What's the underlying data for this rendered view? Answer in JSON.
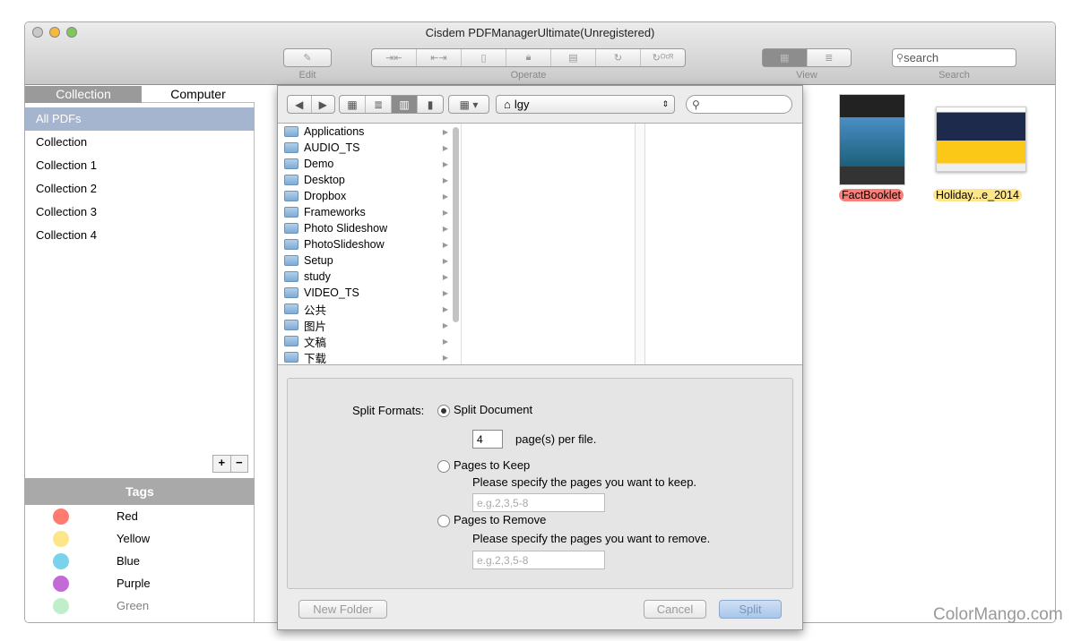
{
  "window": {
    "title": "Cisdem PDFManagerUltimate(Unregistered)"
  },
  "toolbar": {
    "edit_label": "Edit",
    "operate_label": "Operate",
    "view_label": "View",
    "search_label": "Search",
    "search_placeholder": "search",
    "operate_icons": [
      "merge-icon",
      "split-icon",
      "compress-icon",
      "lock-icon",
      "extract-icon",
      "rotate-icon",
      "ocr-icon"
    ]
  },
  "sidebar": {
    "tabs": [
      "Collection",
      "Computer"
    ],
    "items": [
      "All PDFs",
      "Collection",
      "Collection 1",
      "Collection 2",
      "Collection 3",
      "Collection 4"
    ],
    "tags_title": "Tags",
    "tags": [
      {
        "name": "Red",
        "color": "#ff7b72"
      },
      {
        "name": "Yellow",
        "color": "#fde58a"
      },
      {
        "name": "Blue",
        "color": "#79d3ea"
      },
      {
        "name": "Purple",
        "color": "#c46ad6"
      },
      {
        "name": "Green",
        "color": "#7fe095"
      }
    ]
  },
  "documents": [
    {
      "name": "FactBooklet",
      "tag_color": "#f7817a"
    },
    {
      "name": "Holiday...e_2014",
      "tag_color": "#fde58a"
    }
  ],
  "dialog": {
    "location": "lgy",
    "folders": [
      "Applications",
      "AUDIO_TS",
      "Demo",
      "Desktop",
      "Dropbox",
      "Frameworks",
      "Photo Slideshow",
      "PhotoSlideshow",
      "Setup",
      "study",
      "VIDEO_TS",
      "公共",
      "图片",
      "文稿",
      "下载"
    ],
    "split_formats_label": "Split Formats:",
    "split_document": "Split Document",
    "pages_value": "4",
    "per_file": "page(s) per file.",
    "pages_to_keep": "Pages to Keep",
    "keep_hint": "Please specify the pages you want to keep.",
    "keep_placeholder": "e.g.2,3,5-8",
    "pages_to_remove": "Pages to Remove",
    "remove_hint": "Please specify the pages you want to remove.",
    "remove_placeholder": "e.g.2,3,5-8",
    "selected_format": "Split Document",
    "new_folder": "New Folder",
    "cancel": "Cancel",
    "split": "Split"
  },
  "watermark": "ColorMango.com"
}
